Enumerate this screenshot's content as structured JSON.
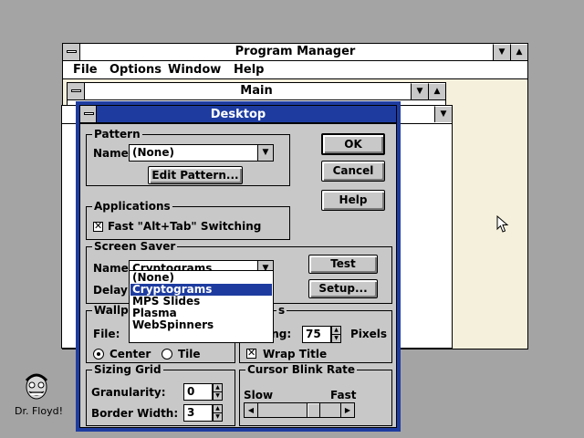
{
  "program_manager": {
    "title": "Program Manager",
    "menu": [
      {
        "label": "File"
      },
      {
        "label": "Options"
      },
      {
        "label": "Window"
      },
      {
        "label": "Help"
      }
    ]
  },
  "main_window": {
    "title": "Main"
  },
  "desktop_dialog": {
    "title": "Desktop",
    "buttons": {
      "ok": "OK",
      "cancel": "Cancel",
      "help": "Help"
    },
    "pattern": {
      "group_label": "Pattern",
      "name_label": "Name:",
      "value": "(None)",
      "edit_button": "Edit Pattern..."
    },
    "applications": {
      "group_label": "Applications",
      "fast_switch_label": "Fast \"Alt+Tab\" Switching",
      "fast_switch_checked": true
    },
    "screen_saver": {
      "group_label": "Screen Saver",
      "name_label": "Name:",
      "value": "Cryptograms",
      "delay_label": "Delay:",
      "test_button": "Test",
      "setup_button": "Setup...",
      "options": [
        "(None)",
        "Cryptograms",
        "MPS Slides",
        "Plasma",
        "WebSpinners"
      ],
      "selected_index": 1
    },
    "wallpaper": {
      "group_label": "Wallpa",
      "file_label": "File:",
      "center_label": "Center",
      "tile_label": "Tile",
      "selected": "Center"
    },
    "icons": {
      "group_label_fragment": "s",
      "spacing_label": "cing:",
      "spacing_value": "75",
      "pixels_label": "Pixels",
      "wrap_title_label": "Wrap Title",
      "wrap_title_checked": true
    },
    "sizing_grid": {
      "group_label": "Sizing Grid",
      "granularity_label": "Granularity:",
      "granularity_value": "0",
      "border_width_label": "Border Width:",
      "border_width_value": "3"
    },
    "cursor_blink": {
      "group_label": "Cursor Blink Rate",
      "slow_label": "Slow",
      "fast_label": "Fast"
    }
  },
  "desktop_icon": {
    "label": "Dr. Floyd!"
  }
}
